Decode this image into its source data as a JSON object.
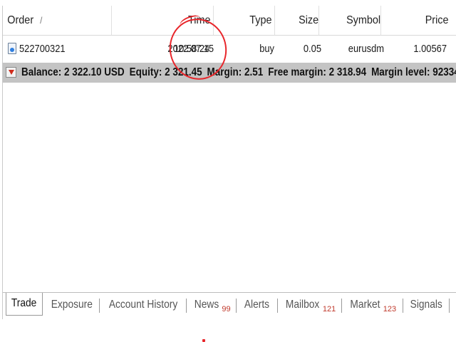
{
  "columns": {
    "order": "Order",
    "order_sort": "/",
    "time": "Time",
    "type": "Type",
    "size": "Size",
    "symbol": "Symbol",
    "price": "Price"
  },
  "order_row": {
    "order": "522700321",
    "date": "2022.07.15",
    "time": "10:58:24",
    "type": "buy",
    "size": "0.05",
    "symbol": "eurusdm",
    "price": "1.00567"
  },
  "summary": {
    "balance": "Balance: 2 322.10 USD",
    "equity": "Equity: 2 321.45",
    "margin": "Margin: 2.51",
    "free_margin": "Free margin: 2 318.94",
    "margin_level": "Margin level: 92334"
  },
  "tabs": [
    {
      "label": "Trade",
      "badge": ""
    },
    {
      "label": "Exposure",
      "badge": ""
    },
    {
      "label": "Account History",
      "badge": ""
    },
    {
      "label": "News",
      "badge": "99"
    },
    {
      "label": "Alerts",
      "badge": ""
    },
    {
      "label": "Mailbox",
      "badge": "121"
    },
    {
      "label": "Market",
      "badge": "123"
    },
    {
      "label": "Signals",
      "badge": ""
    }
  ],
  "active_tab": "Trade",
  "annotation_color": "#e8262b",
  "summary_bg": "#c4c4c4",
  "badge_color": "#c0392b"
}
